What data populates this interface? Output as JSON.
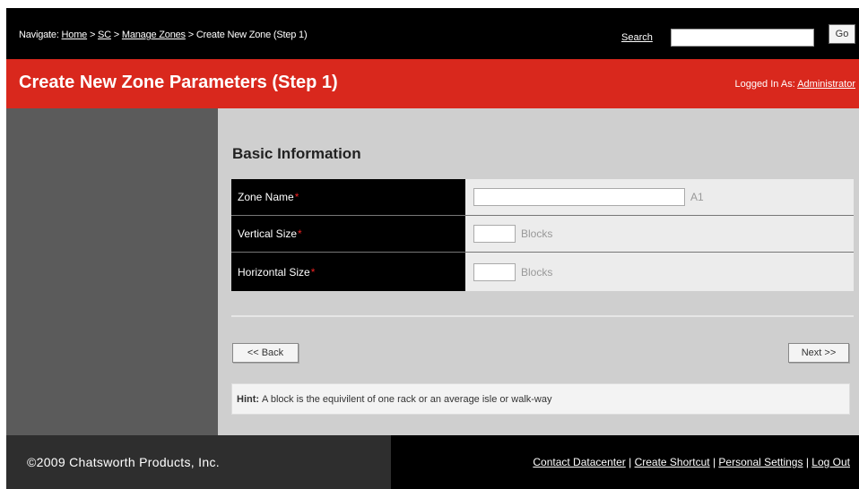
{
  "header": {
    "breadcrumb_prefix": "Navigate:",
    "crumbs": [
      "Home",
      "SC",
      "Manage Zones",
      "Create New Zone (Step 1)"
    ],
    "separator": ">",
    "search_label": "Search",
    "search_value": "",
    "go_label": "Go"
  },
  "titlebar": {
    "title": "Create New Zone Parameters (Step 1)",
    "logged_in_label": "Logged In As:",
    "user": "Administrator"
  },
  "section": {
    "title": "Basic Information"
  },
  "form": {
    "rows": [
      {
        "label": "Zone Name",
        "required": "*",
        "value": "",
        "suffix": "A1"
      },
      {
        "label": "Vertical Size",
        "required": "*",
        "value": "",
        "suffix": "Blocks"
      },
      {
        "label": "Horizontal Size",
        "required": "*",
        "value": "",
        "suffix": "Blocks"
      }
    ]
  },
  "buttons": {
    "back": "<< Back",
    "next": "Next >>"
  },
  "hint": {
    "label": "Hint:",
    "text": "A block is the equivilent of one rack or an average isle or walk-way"
  },
  "footer": {
    "copyright": "©2009 Chatsworth Products, Inc.",
    "links": [
      "Contact Datacenter",
      "Create Shortcut",
      "Personal Settings",
      "Log Out"
    ],
    "separator": "|"
  },
  "colors": {
    "accent_red": "#d9281d",
    "header_black": "#000000",
    "sidebar_gray": "#5b5b5b"
  }
}
